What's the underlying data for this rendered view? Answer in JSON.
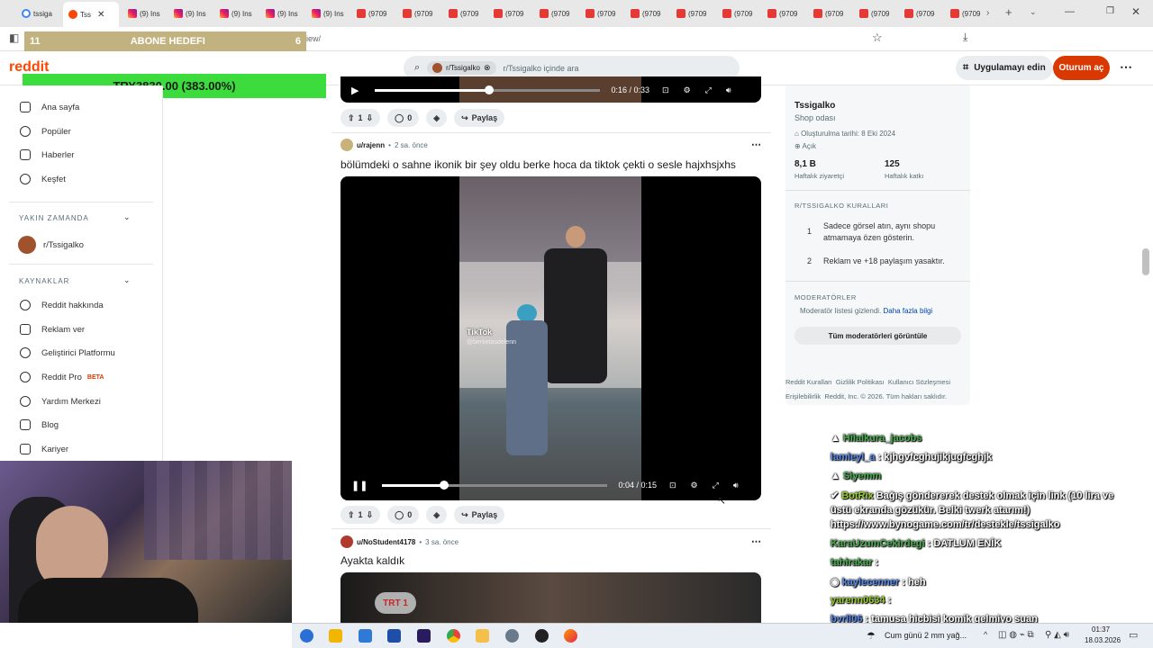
{
  "browser": {
    "tabs": [
      {
        "label": "tssiga",
        "icon": "google-icon"
      },
      {
        "label": "Tss",
        "icon": "reddit-icon",
        "active": true
      },
      {
        "label": "(9) Ins",
        "icon": "instagram-icon"
      },
      {
        "label": "(9) Ins",
        "icon": "instagram-icon"
      },
      {
        "label": "(9) Ins",
        "icon": "instagram-icon"
      },
      {
        "label": "(9) Ins",
        "icon": "instagram-icon"
      },
      {
        "label": "(9) Ins",
        "icon": "instagram-icon"
      },
      {
        "label": "(9709",
        "icon": "youtube-icon"
      },
      {
        "label": "(9709",
        "icon": "youtube-icon"
      },
      {
        "label": "(9709",
        "icon": "youtube-icon"
      },
      {
        "label": "(9709",
        "icon": "youtube-icon"
      },
      {
        "label": "(9709",
        "icon": "youtube-icon"
      },
      {
        "label": "(9709",
        "icon": "youtube-icon"
      },
      {
        "label": "(9709",
        "icon": "youtube-icon"
      },
      {
        "label": "(9709",
        "icon": "youtube-icon"
      },
      {
        "label": "(9709",
        "icon": "youtube-icon"
      },
      {
        "label": "(9709",
        "icon": "youtube-icon"
      },
      {
        "label": "(9709",
        "icon": "youtube-icon"
      },
      {
        "label": "(9709",
        "icon": "youtube-icon"
      },
      {
        "label": "(9709",
        "icon": "youtube-icon"
      },
      {
        "label": "(9709",
        "icon": "youtube-icon"
      },
      {
        "label": "(9709",
        "icon": "youtube-icon"
      }
    ],
    "url_fragment": "iew/"
  },
  "overlay": {
    "goal_left": "11",
    "goal_label": "ABONE HEDEFI",
    "goal_right": "6",
    "donation": "TRY3830.00 (383.00%)"
  },
  "header": {
    "logo": "reddit",
    "search_chip": "r/Tssigalko",
    "search_placeholder": "r/Tssigalko içinde ara",
    "app_button": "Uygulamayı edin",
    "login_button": "Oturum aç"
  },
  "sidebar": {
    "top_items": [
      "Ana sayfa",
      "Popüler",
      "Haberler",
      "Keşfet"
    ],
    "recent_heading": "YAKIN ZAMANDA",
    "recent_items": [
      "r/Tssigalko"
    ],
    "resources_heading": "KAYNAKLAR",
    "resource_items": [
      "Reddit hakkında",
      "Reklam ver",
      "Geliştirici Platformu",
      "Reddit Pro",
      "Yardım Merkezi",
      "Blog",
      "Kariyer"
    ],
    "beta_badge": "BETA"
  },
  "feed": {
    "video1": {
      "time": "0:16 / 0:33"
    },
    "post1_actions": {
      "votes": "1",
      "comments": "0",
      "share": "Paylaş"
    },
    "post2": {
      "user": "u/rajenn",
      "age": "2 sa. önce",
      "title": "bölümdeki o sahne ikonik bir şey oldu berke hoca da tiktok çekti o sesle hajxhsjxhs",
      "tiktok_label": "TikTok",
      "tiktok_handle": "@berketasdelenn",
      "time": "0:04 / 0:15",
      "votes": "1",
      "comments": "0",
      "share": "Paylaş"
    },
    "post3": {
      "user": "u/NoStudent4178",
      "age": "3 sa. önce",
      "title": "Ayakta kaldık",
      "watermark": "TRT 1"
    }
  },
  "community": {
    "name": "Tssigalko",
    "subtitle": "Shop odası",
    "created": "Oluşturulma tarihi: 8 Eki 2024",
    "visibility": "Açık",
    "visitors": "8,1 B",
    "visitors_label": "Haftalık ziyaretçi",
    "contributions": "125",
    "contributions_label": "Haftalık katkı",
    "rules_heading": "R/TSSIGALKO KURALLARI",
    "rules": [
      {
        "num": "1",
        "text": "Sadece görsel atın, aynı shopu atmamaya özen gösterin."
      },
      {
        "num": "2",
        "text": "Reklam ve +18 paylaşım yasaktır."
      }
    ],
    "mods_heading": "MODERATÖRLER",
    "mods_hidden": "Moderatör listesi gizlendi.",
    "mods_more": "Daha fazla bilgi",
    "mods_button": "Tüm moderatörleri görüntüle",
    "footer_links": [
      "Reddit Kuralları",
      "Gizlilik Politikası",
      "Kullanıcı Sözleşmesi",
      "Erişilebilirlik"
    ],
    "copyright": "Reddit, Inc. © 2026. Tüm hakları saklıdır."
  },
  "chat": [
    {
      "user": "Hilalkura_jacobs",
      "msg": ""
    },
    {
      "user": "lamleyl_a",
      "msg": "kjhgvfcghujikjugfcghjk"
    },
    {
      "user": "Siyemm",
      "msg": ""
    },
    {
      "user": "BotRix",
      "msg": "Bağış göndererek destek olmak için link (10 lira ve"
    },
    {
      "user": "",
      "msg": "üstü ekranda gözükür. Belki twerk atarım!)"
    },
    {
      "user": "",
      "msg": "https://www.bynogame.com/tr/destekle/tssigalko"
    },
    {
      "user": "KaraUzumCekirdegi",
      "msg": "DATLUM ENİK"
    },
    {
      "user": "tahirakar",
      "msg": ""
    },
    {
      "user": "kaylecenner",
      "msg": "heh"
    },
    {
      "user": "yarenn0634",
      "msg": ""
    },
    {
      "user": "bvrll06",
      "msg": "tamusa hicbisi komik gelmiyo suan"
    }
  ],
  "taskbar": {
    "weather": "Cum günü 2 mm yağ...",
    "time": "01:37",
    "date": "18.03.2026"
  },
  "colors": {
    "reddit_orange": "#ff4500",
    "login_red": "#d93900",
    "donation_green": "#3cdc3c",
    "goal_gold": "#c2b280"
  }
}
